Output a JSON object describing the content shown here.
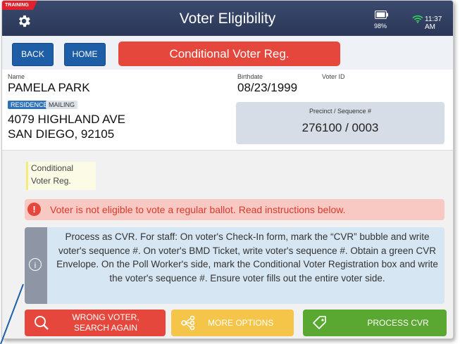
{
  "header": {
    "badge": "TRAINING",
    "title": "Voter Eligibility",
    "battery_pct": "98%",
    "time": "11:37 AM"
  },
  "nav": {
    "back_label": "BACK",
    "home_label": "HOME",
    "status_label": "Conditional Voter Reg."
  },
  "voter": {
    "name_label": "Name",
    "name": "PAMELA PARK",
    "tag_residence": "RESIDENCE",
    "tag_mailing": "MAILING",
    "address_line1": "4079 HIGHLAND AVE",
    "address_line2": "SAN DIEGO, 92105",
    "birthdate_label": "Birthdate",
    "birthdate": "08/23/1999",
    "voter_id_label": "Voter ID",
    "precinct_label": "Precinct / Sequence #",
    "precinct_value": "276100 / 0003"
  },
  "notice": {
    "note_line1": "Conditional",
    "note_line2": "Voter Reg.",
    "alert_text": "Voter is not eligible to vote a regular ballot.  Read instructions below.",
    "info_text": "Process as CVR. For staff: On voter's Check-In form, mark the “CVR” bubble and write voter's sequence #. On voter's BMD Ticket, write voter's sequence #. Obtain a green CVR Envelope. On the Poll Worker's side, mark the Conditional Voter Registration box and write the voter's sequence #. Ensure voter fills out the entire voter side."
  },
  "footer": {
    "wrong_voter_line1": "WRONG VOTER,",
    "wrong_voter_line2": "SEARCH AGAIN",
    "more_options": "MORE OPTIONS",
    "process_cvr": "PROCESS CVR"
  },
  "colors": {
    "header": "#2f3c5e",
    "primary_button": "#1e5ea6",
    "alert_red": "#e5473c",
    "more_yellow": "#f5c54a",
    "process_green": "#5aa832"
  }
}
